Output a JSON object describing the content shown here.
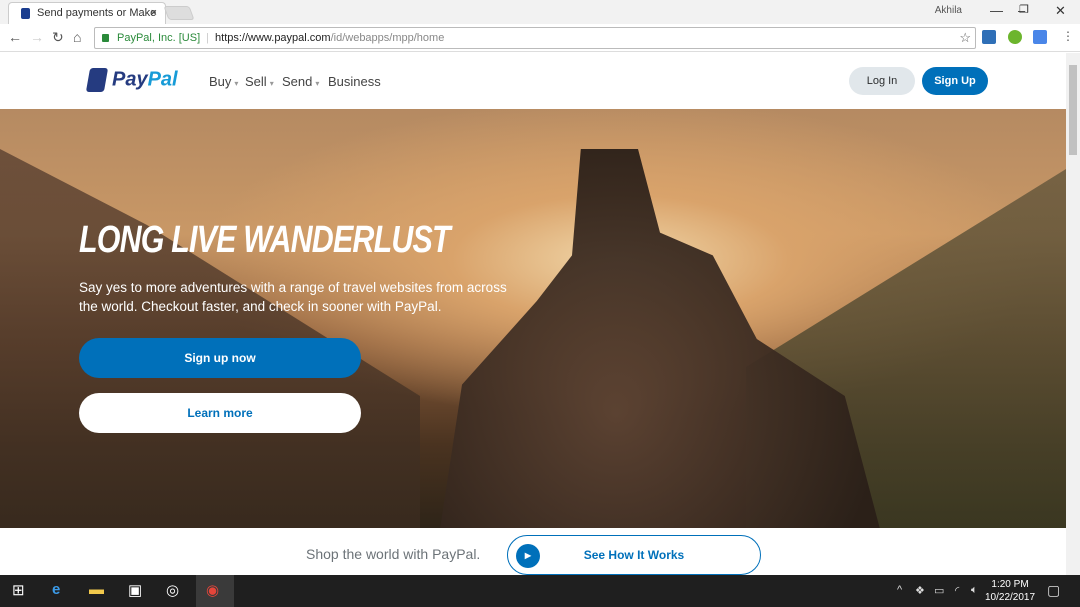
{
  "browser": {
    "tab_title": "Send payments or Make",
    "user": "Akhila",
    "security_label": "PayPal, Inc. [US]",
    "url_scheme_host": "https://www.paypal.com",
    "url_path": "/id/webapps/mpp/home"
  },
  "header": {
    "logo_pay": "Pay",
    "logo_pal": "Pal",
    "nav": [
      {
        "label": "Buy",
        "caret": true
      },
      {
        "label": "Sell",
        "caret": true
      },
      {
        "label": "Send",
        "caret": true
      },
      {
        "label": "Business",
        "caret": false
      }
    ],
    "login": "Log In",
    "signup": "Sign Up"
  },
  "hero": {
    "title": "LONG LIVE WANDERLUST",
    "subtitle": "Say yes to more adventures with a range of travel websites from across the world. Checkout faster, and check in sooner with PayPal.",
    "primary_button": "Sign up now",
    "secondary_button": "Learn more"
  },
  "strip": {
    "text": "Shop the world with PayPal.",
    "button": "See How It Works"
  },
  "taskbar": {
    "time": "1:20 PM",
    "date": "10/22/2017"
  },
  "colors": {
    "brand_blue": "#0070ba",
    "logo_dark": "#253b80",
    "logo_light": "#179bd7"
  }
}
